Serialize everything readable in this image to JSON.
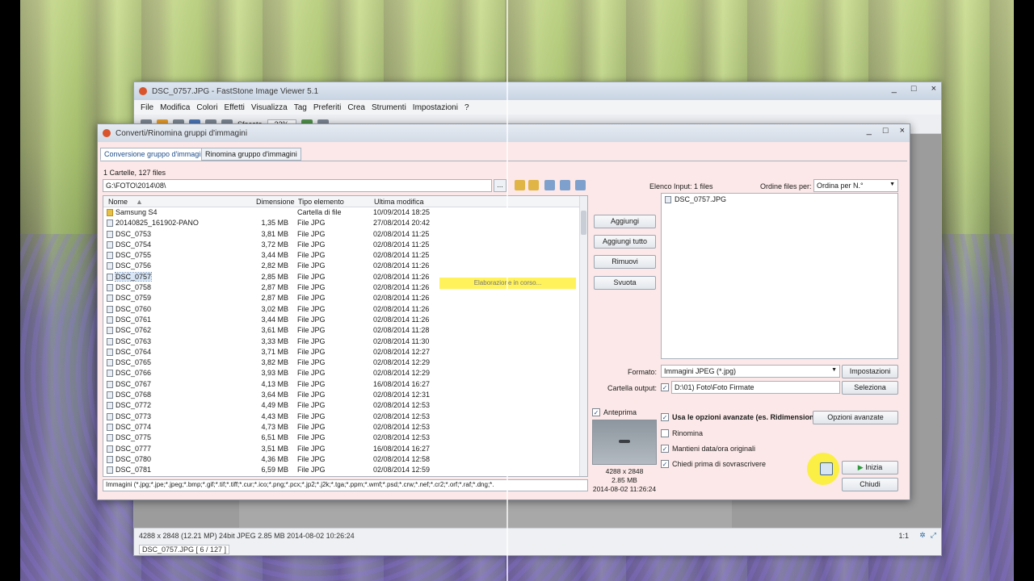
{
  "main_window": {
    "title": "DSC_0757.JPG - FastStone Image Viewer 5.1",
    "window_buttons": [
      "_",
      "□",
      "×"
    ],
    "menu": [
      "File",
      "Modifica",
      "Colori",
      "Effetti",
      "Visualizza",
      "Tag",
      "Preferiti",
      "Crea",
      "Strumenti",
      "Impostazioni",
      "?"
    ],
    "toolbar": {
      "blur_label": "Sfocato",
      "zoom_value": "22%"
    },
    "status": {
      "info": "4288 x 2848 (12.21 MP)  24bit  JPEG  2.85 MB  2014-08-02 10:26:24",
      "file": "DSC_0757.JPG [ 6 / 127 ]",
      "zoom": "1:1"
    }
  },
  "dialog": {
    "title": "Converti/Rinomina gruppi d'immagini",
    "window_buttons": [
      "_",
      "□",
      "×"
    ],
    "tabs": [
      "Conversione gruppo d'immagini",
      "Rinomina gruppo d'immagini"
    ],
    "folder_count": "1 Cartelle, 127 files",
    "path": "G:\\FOTO\\2014\\08\\",
    "path_button": "...",
    "columns": {
      "name": "Nome",
      "size": "Dimensione",
      "type": "Tipo elemento",
      "date": "Ultima modifica"
    },
    "files": [
      {
        "name": "Samsung S4",
        "size": "",
        "type": "Cartella di file",
        "date": "10/09/2014 18:25",
        "folder": true
      },
      {
        "name": "20140825_161902-PANO",
        "size": "1,35 MB",
        "type": "File JPG",
        "date": "27/08/2014 20:42"
      },
      {
        "name": "DSC_0753",
        "size": "3,81 MB",
        "type": "File JPG",
        "date": "02/08/2014 11:25"
      },
      {
        "name": "DSC_0754",
        "size": "3,72 MB",
        "type": "File JPG",
        "date": "02/08/2014 11:25"
      },
      {
        "name": "DSC_0755",
        "size": "3,44 MB",
        "type": "File JPG",
        "date": "02/08/2014 11:25"
      },
      {
        "name": "DSC_0756",
        "size": "2,82 MB",
        "type": "File JPG",
        "date": "02/08/2014 11:26"
      },
      {
        "name": "DSC_0757",
        "size": "2,85 MB",
        "type": "File JPG",
        "date": "02/08/2014 11:26",
        "selected": true
      },
      {
        "name": "DSC_0758",
        "size": "2,87 MB",
        "type": "File JPG",
        "date": "02/08/2014 11:26"
      },
      {
        "name": "DSC_0759",
        "size": "2,87 MB",
        "type": "File JPG",
        "date": "02/08/2014 11:26"
      },
      {
        "name": "DSC_0760",
        "size": "3,02 MB",
        "type": "File JPG",
        "date": "02/08/2014 11:26"
      },
      {
        "name": "DSC_0761",
        "size": "3,44 MB",
        "type": "File JPG",
        "date": "02/08/2014 11:26"
      },
      {
        "name": "DSC_0762",
        "size": "3,61 MB",
        "type": "File JPG",
        "date": "02/08/2014 11:28"
      },
      {
        "name": "DSC_0763",
        "size": "3,33 MB",
        "type": "File JPG",
        "date": "02/08/2014 11:30"
      },
      {
        "name": "DSC_0764",
        "size": "3,71 MB",
        "type": "File JPG",
        "date": "02/08/2014 12:27"
      },
      {
        "name": "DSC_0765",
        "size": "3,82 MB",
        "type": "File JPG",
        "date": "02/08/2014 12:29"
      },
      {
        "name": "DSC_0766",
        "size": "3,93 MB",
        "type": "File JPG",
        "date": "02/08/2014 12:29"
      },
      {
        "name": "DSC_0767",
        "size": "4,13 MB",
        "type": "File JPG",
        "date": "16/08/2014 16:27"
      },
      {
        "name": "DSC_0768",
        "size": "3,64 MB",
        "type": "File JPG",
        "date": "02/08/2014 12:31"
      },
      {
        "name": "DSC_0772",
        "size": "4,49 MB",
        "type": "File JPG",
        "date": "02/08/2014 12:53"
      },
      {
        "name": "DSC_0773",
        "size": "4,43 MB",
        "type": "File JPG",
        "date": "02/08/2014 12:53"
      },
      {
        "name": "DSC_0774",
        "size": "4,73 MB",
        "type": "File JPG",
        "date": "02/08/2014 12:53"
      },
      {
        "name": "DSC_0775",
        "size": "6,51 MB",
        "type": "File JPG",
        "date": "02/08/2014 12:53"
      },
      {
        "name": "DSC_0777",
        "size": "3,51 MB",
        "type": "File JPG",
        "date": "16/08/2014 16:27"
      },
      {
        "name": "DSC_0780",
        "size": "4,36 MB",
        "type": "File JPG",
        "date": "02/08/2014 12:58"
      },
      {
        "name": "DSC_0781",
        "size": "6,59 MB",
        "type": "File JPG",
        "date": "02/08/2014 12:59"
      }
    ],
    "processing": "Elaborazione in corso...",
    "filter": "Immagini (*.jpg;*.jpe;*.jpeg;*.bmp;*.gif;*.tif;*.tiff;*.cur;*.ico;*.png;*.pcx;*.jp2;*.j2k;*.tga;*.ppm;*.wmf;*.psd;*.crw;*.nef;*.cr2;*.orf;*.raf;*.dng;*.",
    "buttons": {
      "add": "Aggiungi",
      "add_all": "Aggiungi tutto",
      "remove": "Rimuovi",
      "clear": "Svuota",
      "settings": "Impostazioni",
      "select": "Seleziona",
      "advanced": "Opzioni avanzate",
      "start": "Inizia",
      "close": "Chiudi"
    },
    "input_list_label": "Elenco Input:  1 files",
    "sort_label": "Ordine files per:",
    "sort_value": "Ordina per N.°",
    "input_files": [
      "DSC_0757.JPG"
    ],
    "format_label": "Formato:",
    "format_value": "Immagini JPEG (*.jpg)",
    "output_label": "Cartella output:",
    "output_value": "D:\\01) Foto\\Foto Firmate",
    "preview_label": "Anteprima",
    "preview_dims": "4288 x 2848",
    "preview_size": "2.85 MB",
    "preview_date": "2014-08-02 11:26:24",
    "options": [
      {
        "label": "Usa le opzioni avanzate (es. Ridimension",
        "checked": true,
        "bold": true
      },
      {
        "label": "Rinomina",
        "checked": false
      },
      {
        "label": "Mantieni data/ora originali",
        "checked": true
      },
      {
        "label": "Chiedi prima di sovrascrivere",
        "checked": true
      }
    ]
  }
}
